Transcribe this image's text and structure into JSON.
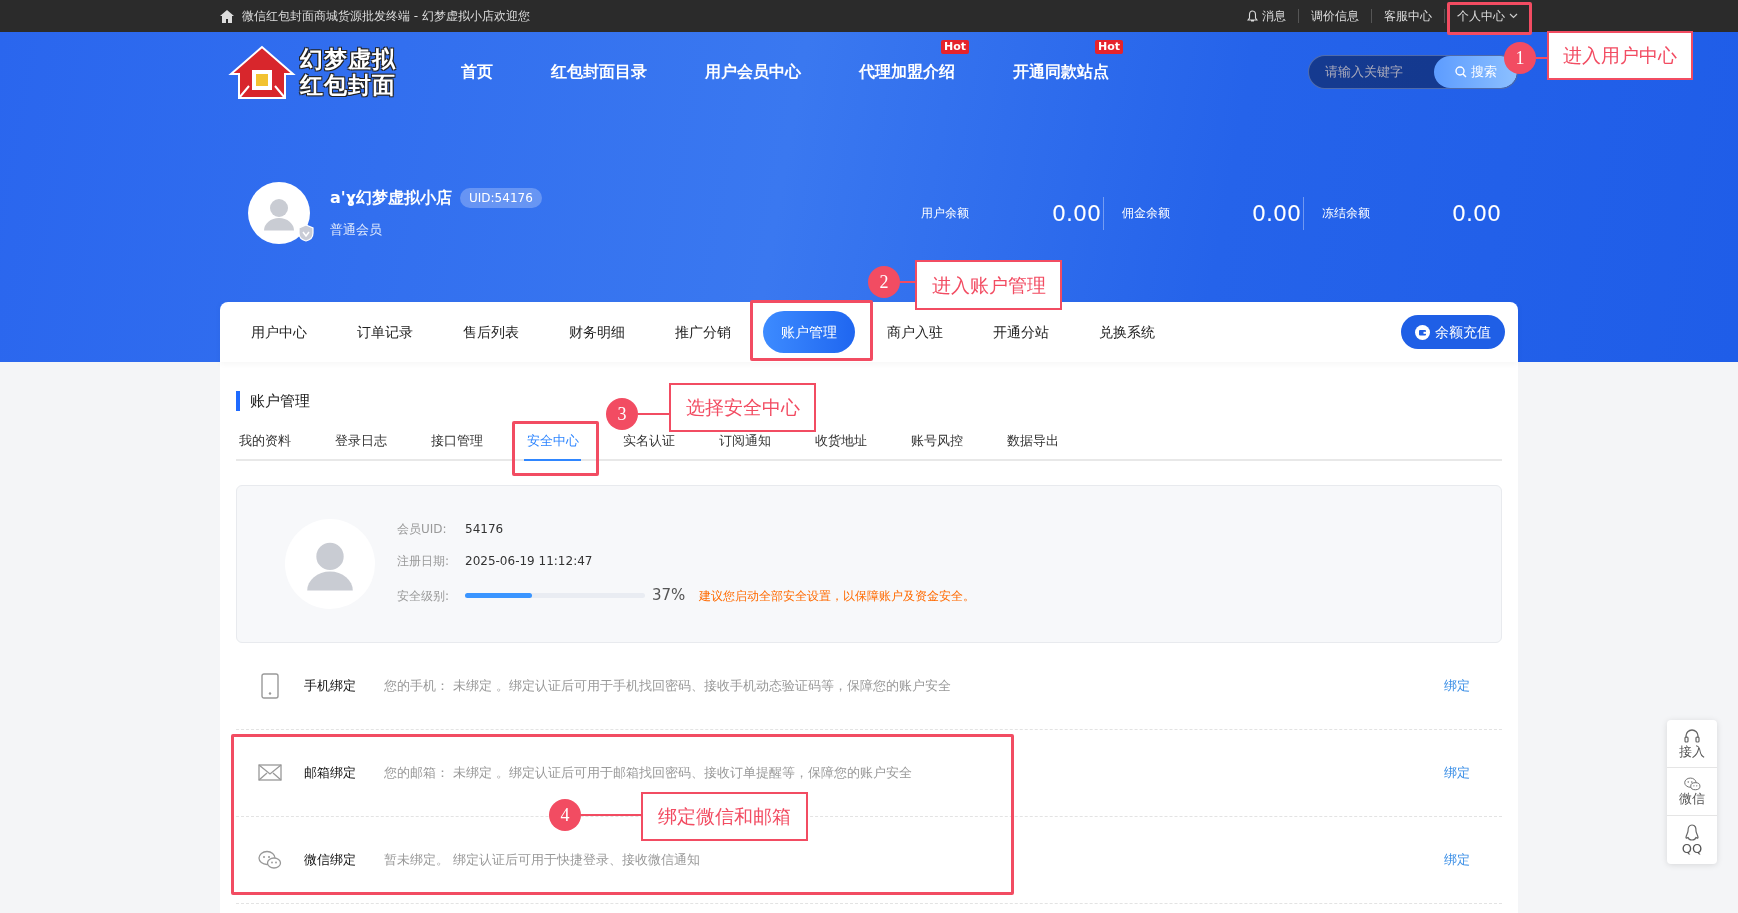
{
  "top_bar": {
    "welcome": "微信红包封面商城货源批发终端 - 幻梦虚拟小店欢迎您",
    "links": [
      {
        "kind": "bell",
        "label": "消息"
      },
      {
        "kind": "plain",
        "label": "调价信息"
      },
      {
        "kind": "plain",
        "label": "客服中心"
      },
      {
        "kind": "dropdown",
        "label": "个人中心"
      }
    ]
  },
  "header": {
    "logo": [
      "幻梦虚拟",
      "红包封面"
    ],
    "nav": [
      {
        "label": "首页"
      },
      {
        "label": "红包封面目录"
      },
      {
        "label": "用户会员中心"
      },
      {
        "label": "代理加盟介绍",
        "badge": "Hot"
      },
      {
        "label": "开通同款站点",
        "badge": "Hot"
      }
    ],
    "search": {
      "placeholder": "请输入关键字",
      "button": "搜索"
    }
  },
  "profile": {
    "name": "a'ɣ幻梦虚拟小店",
    "uid": "UID:54176",
    "member_level": "普通会员"
  },
  "balances": [
    {
      "label": "用户余额",
      "value": "0.00"
    },
    {
      "label": "佣金余额",
      "value": "0.00"
    },
    {
      "label": "冻结余额",
      "value": "0.00"
    }
  ],
  "main_tabs": [
    {
      "label": "用户中心",
      "selected": false
    },
    {
      "label": "订单记录",
      "selected": false
    },
    {
      "label": "售后列表",
      "selected": false
    },
    {
      "label": "财务明细",
      "selected": false
    },
    {
      "label": "推广分销",
      "selected": false
    },
    {
      "label": "账户管理",
      "selected": true
    },
    {
      "label": "商户入驻",
      "selected": false
    },
    {
      "label": "开通分站",
      "selected": false
    },
    {
      "label": "兑换系统",
      "selected": false
    }
  ],
  "recharge_button": "余额充值",
  "section_title": "账户管理",
  "sub_tabs": [
    {
      "label": "我的资料",
      "selected": false
    },
    {
      "label": "登录日志",
      "selected": false
    },
    {
      "label": "接口管理",
      "selected": false
    },
    {
      "label": "安全中心",
      "selected": true
    },
    {
      "label": "实名认证",
      "selected": false
    },
    {
      "label": "订阅通知",
      "selected": false
    },
    {
      "label": "收货地址",
      "selected": false
    },
    {
      "label": "账号风控",
      "selected": false
    },
    {
      "label": "数据导出",
      "selected": false
    }
  ],
  "security": {
    "fields": [
      {
        "label": "会员UID:",
        "value": "54176"
      },
      {
        "label": "注册日期:",
        "value": "2025-06-19 11:12:47"
      }
    ],
    "level_label": "安全级别:",
    "level": 0.37,
    "percent": "37%",
    "advice": "建议您启动全部安全设置，以保障账户及资金安全。"
  },
  "bindings": [
    {
      "kind": "phone",
      "title": "手机绑定",
      "description": "您的手机： 未绑定 。绑定认证后可用于手机找回密码、接收手机动态验证码等，保障您的账户安全",
      "action": "绑定"
    },
    {
      "kind": "email",
      "title": "邮箱绑定",
      "description": "您的邮箱： 未绑定 。绑定认证后可用于邮箱找回密码、接收订单提醒等，保障您的账户安全",
      "action": "绑定"
    },
    {
      "kind": "wechat",
      "title": "微信绑定",
      "description": "暂未绑定。 绑定认证后可用于快捷登录、接收微信通知",
      "action": "绑定"
    }
  ],
  "side_widget": [
    {
      "kind": "headset",
      "label": "接入"
    },
    {
      "kind": "wechat",
      "label": "微信"
    },
    {
      "kind": "qq",
      "label": "QQ"
    }
  ],
  "annotations": [
    {
      "number": "1",
      "text": "进入用户中心"
    },
    {
      "number": "2",
      "text": "进入账户管理"
    },
    {
      "number": "3",
      "text": "选择安全中心"
    },
    {
      "number": "4",
      "text": "绑定微信和邮箱"
    }
  ]
}
